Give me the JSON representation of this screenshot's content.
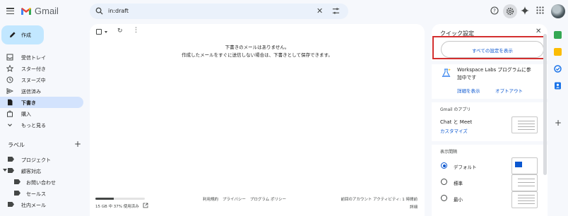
{
  "app": {
    "name": "Gmail"
  },
  "search": {
    "query": "in:draft"
  },
  "compose": {
    "label": "作成"
  },
  "nav": {
    "items": [
      {
        "label": "受信トレイ",
        "icon": "inbox-icon"
      },
      {
        "label": "スター付き",
        "icon": "star-icon"
      },
      {
        "label": "スヌーズ中",
        "icon": "clock-icon"
      },
      {
        "label": "送信済み",
        "icon": "send-icon"
      },
      {
        "label": "下書き",
        "icon": "draft-icon",
        "active": true
      },
      {
        "label": "購入",
        "icon": "bag-icon"
      },
      {
        "label": "もっと見る",
        "icon": "chevron-down-icon"
      }
    ]
  },
  "labels": {
    "heading": "ラベル",
    "items": [
      {
        "label": "プロジェクト"
      },
      {
        "label": "顧客対応"
      },
      {
        "label": "お問い合わせ"
      },
      {
        "label": "セールス"
      },
      {
        "label": "社内メール"
      }
    ]
  },
  "main": {
    "empty_line1": "下書きのメールはありません。",
    "empty_line2": "作成したメールをすぐに送信しない場合は、下書きとして保存できます。",
    "storage_text": "15 GB 中 37% 使用済み",
    "storage_fraction": 0.37,
    "footer_links": [
      "利用規約",
      "プライバシー",
      "プログラム ポリシー"
    ],
    "activity": "前回のアカウント アクティビティ: 1 時間前",
    "details": "詳細"
  },
  "quick_settings": {
    "title": "クイック設定",
    "all_settings": "すべての設定を表示",
    "labs_text": "Workspace Labs プログラムに参加中です",
    "labs_show": "詳細を表示",
    "labs_optout": "オプトアウト",
    "apps_heading": "Gmail のアプリ",
    "apps_chat": "Chat と Meet",
    "apps_customize": "カスタマイズ",
    "density_heading": "表示間隔",
    "density_options": [
      {
        "label": "デフォルト",
        "selected": true
      },
      {
        "label": "標準",
        "selected": false
      },
      {
        "label": "最小",
        "selected": false
      }
    ]
  },
  "colors": {
    "accent": "#0b57d0",
    "compose_bg": "#c2e7ff",
    "active_nav": "#d3e3fd",
    "highlight": "#d32f2f"
  }
}
